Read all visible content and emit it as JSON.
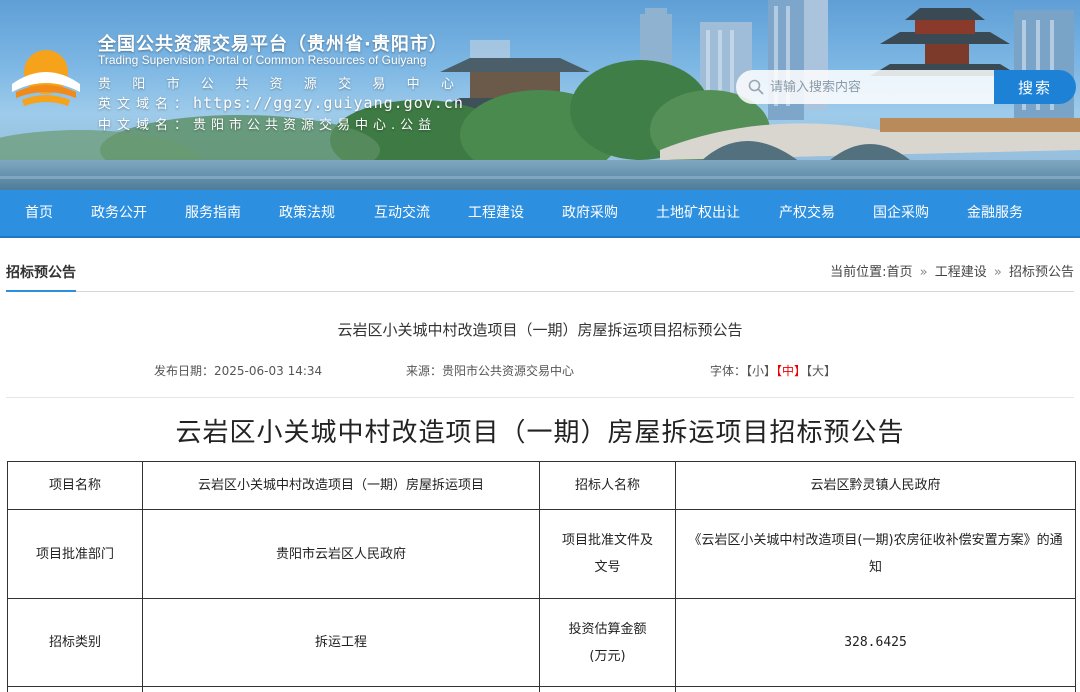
{
  "header": {
    "title_cn": "全国公共资源交易平台（贵州省·贵阳市）",
    "title_en": "Trading Supervision Portal of Common Resources of Guiyang",
    "center_name_chars": [
      "贵",
      "阳",
      "市",
      "公",
      "共",
      "资",
      "源",
      "交",
      "易",
      "中",
      "心"
    ],
    "en_domain_label": "英文域名：",
    "en_domain_value": "https://ggzy.guiyang.gov.cn",
    "cn_domain_label": "中文域名：",
    "cn_domain_value": "贵阳市公共资源交易中心.公益"
  },
  "search": {
    "placeholder": "请输入搜索内容",
    "button_label": "搜索"
  },
  "nav": {
    "items": [
      "首页",
      "政务公开",
      "服务指南",
      "政策法规",
      "互动交流",
      "工程建设",
      "政府采购",
      "土地矿权出让",
      "产权交易",
      "国企采购",
      "金融服务"
    ]
  },
  "section": {
    "title": "招标预公告",
    "breadcrumb_prefix": "当前位置:",
    "breadcrumb": [
      "首页",
      "工程建设",
      "招标预公告"
    ],
    "separator": "»"
  },
  "article": {
    "title": "云岩区小关城中村改造项目（一期）房屋拆运项目招标预公告",
    "publish_label": "发布日期：",
    "publish_date": "2025-06-03 14:34",
    "source_label": "来源：",
    "source": "贵阳市公共资源交易中心",
    "font_label": "字体：",
    "font_sizes": [
      "【小】",
      "【中】",
      "【大】"
    ],
    "active_font": "【中】",
    "doc_title": "云岩区小关城中村改造项目（一期）房屋拆运项目招标预公告"
  },
  "table": {
    "rows": [
      [
        "项目名称",
        "云岩区小关城中村改造项目（一期）房屋拆运项目",
        "招标人名称",
        "云岩区黔灵镇人民政府"
      ],
      [
        "项目批准部门",
        "贵阳市云岩区人民政府",
        "项目批准文件及文号",
        "《云岩区小关城中村改造项目(一期)农房征收补偿安置方案》的通知"
      ],
      [
        "招标类别",
        "拆运工程",
        "投资估算金额(万元)",
        "328.6425"
      ]
    ]
  },
  "colors": {
    "nav_bg": "#2d8fe0",
    "search_button": "#1d82d6",
    "active_font_size": "#ee0000"
  }
}
